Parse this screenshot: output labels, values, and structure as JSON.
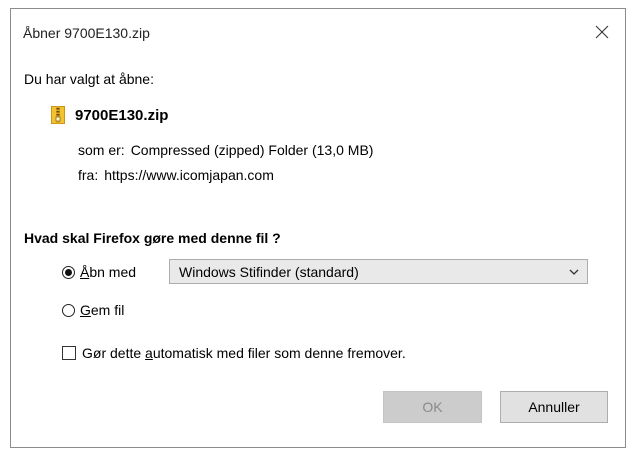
{
  "window": {
    "title": "Åbner 9700E130.zip",
    "close_icon": "close-icon"
  },
  "dialog": {
    "intro": "Du har valgt at åbne:",
    "file": {
      "icon": "zip-folder-icon",
      "name": "9700E130.zip"
    },
    "type_label": "som er:",
    "type_value": "Compressed (zipped) Folder (13,0 MB)",
    "from_label": "fra:",
    "from_value": "https://www.icomjapan.com",
    "question": "Hvad skal Firefox gøre med denne fil ?",
    "open_with": {
      "label_key": "Å",
      "label_rest": "bn med",
      "selected": true,
      "app": "Windows Stifinder (standard)"
    },
    "save_file": {
      "label_key": "G",
      "label_rest": "em fil",
      "selected": false
    },
    "auto": {
      "label_pre": "Gør dette ",
      "label_key": "a",
      "label_post": "utomatisk med filer som denne fremover.",
      "checked": false
    }
  },
  "buttons": {
    "ok": "OK",
    "cancel": "Annuller"
  },
  "colors": {
    "button_disabled_bg": "#cccccc",
    "button_disabled_text": "#8a8a8a",
    "button_bg": "#e1e1e1",
    "select_bg": "#e9e9e9",
    "zip_icon_yellow": "#f2c230"
  }
}
